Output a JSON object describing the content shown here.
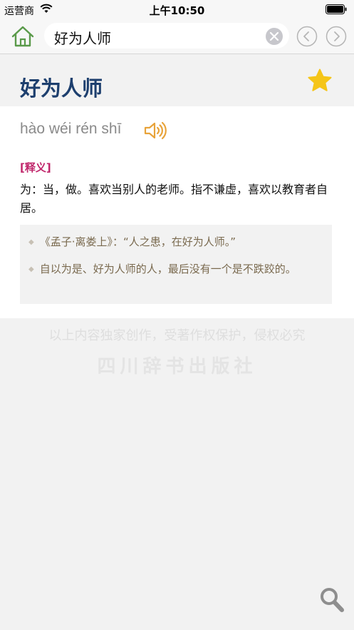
{
  "status_bar": {
    "carrier": "运营商",
    "time": "上午10:50"
  },
  "nav": {
    "search_value": "好为人师",
    "icons": {
      "home": "home-icon",
      "clear": "clear-icon",
      "back": "chevron-left-icon",
      "forward": "chevron-right-icon"
    }
  },
  "entry": {
    "title": "好为人师",
    "pinyin": "hào wéi rén shī",
    "section_label": "[释义]",
    "definition": "为：当，做。喜欢当别人的老师。指不谦虚，喜欢以教育者自居。",
    "examples": [
      "《孟子·离娄上》：“人之患，在好为人师。”",
      "自以为是、好为人师的人，最后没有一个是不跌跤的。"
    ]
  },
  "footer": {
    "copyright": "以上内容独家创作，受著作权保护，侵权必究",
    "publisher": "四川辞书出版社"
  },
  "colors": {
    "title": "#1d3f6e",
    "label": "#c0266b",
    "star": "#f5c518",
    "speaker": "#e8a33a",
    "home": "#5a9a4a"
  }
}
